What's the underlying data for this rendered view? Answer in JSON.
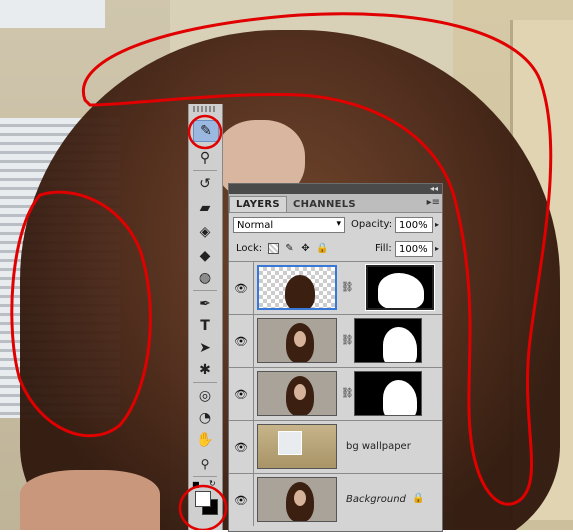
{
  "toolbar": {
    "tools": [
      {
        "icon": "brush-icon",
        "glyph": "✎",
        "active": true
      },
      {
        "icon": "stamp-icon",
        "glyph": "⚲",
        "active": false
      },
      {
        "icon": "history-brush-icon",
        "glyph": "↺",
        "active": false
      },
      {
        "icon": "eraser-icon",
        "glyph": "▰",
        "active": false
      },
      {
        "icon": "paint-bucket-icon",
        "glyph": "◈",
        "active": false
      },
      {
        "icon": "blur-icon",
        "glyph": "◆",
        "active": false
      },
      {
        "icon": "dodge-icon",
        "glyph": "◍",
        "active": false
      },
      {
        "icon": "pen-icon",
        "glyph": "✒",
        "active": false
      },
      {
        "icon": "type-icon",
        "glyph": "T",
        "active": false
      },
      {
        "icon": "path-selection-icon",
        "glyph": "➤",
        "active": false
      },
      {
        "icon": "shape-icon",
        "glyph": "✱",
        "active": false
      },
      {
        "icon": "3d-rotate-icon",
        "glyph": "◎",
        "active": false
      },
      {
        "icon": "3d-camera-icon",
        "glyph": "◔",
        "active": false
      },
      {
        "icon": "hand-icon",
        "glyph": "✋",
        "active": false
      },
      {
        "icon": "zoom-icon",
        "glyph": "🔍",
        "active": false
      }
    ],
    "foreground_color": "#ffffff",
    "background_color": "#000000"
  },
  "layers_panel": {
    "tabs": [
      "LAYERS",
      "CHANNELS"
    ],
    "active_tab": "LAYERS",
    "blend_mode": "Normal",
    "opacity_label": "Opacity:",
    "opacity_value": "100%",
    "lock_label": "Lock:",
    "fill_label": "Fill:",
    "fill_value": "100%",
    "layers": [
      {
        "name": "",
        "has_mask": true,
        "selected": true,
        "thumb": "transparent-head"
      },
      {
        "name": "",
        "has_mask": true,
        "selected": false,
        "thumb": "portrait"
      },
      {
        "name": "",
        "has_mask": true,
        "selected": false,
        "thumb": "portrait"
      },
      {
        "name": "bg wallpaper",
        "has_mask": false,
        "selected": false,
        "thumb": "room"
      },
      {
        "name": "Background",
        "has_mask": false,
        "selected": false,
        "thumb": "portrait",
        "locked": true
      }
    ]
  },
  "colors": {
    "annotation": "#e00000",
    "selection": "#3a78d8"
  }
}
